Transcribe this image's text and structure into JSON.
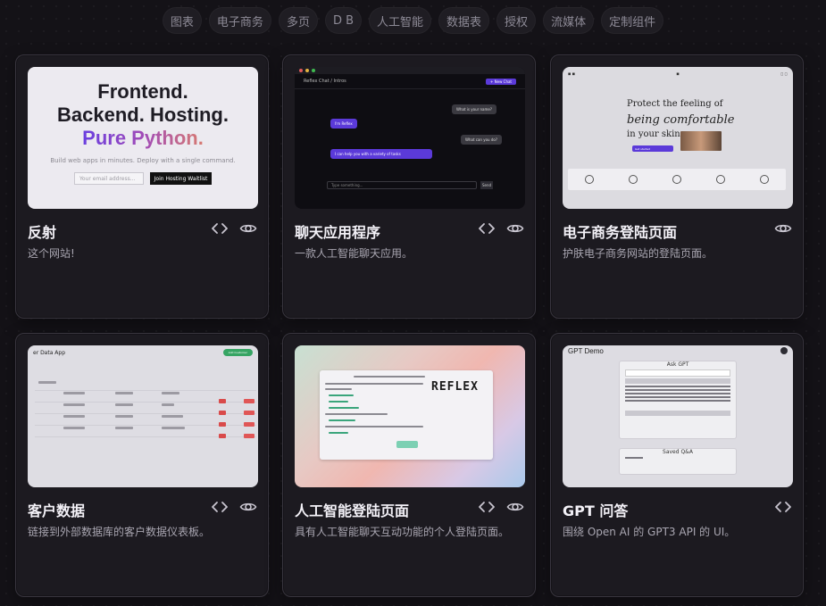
{
  "filters": [
    "图表",
    "电子商务",
    "多页",
    "D B",
    "人工智能",
    "数据表",
    "授权",
    "流媒体",
    "定制组件"
  ],
  "cards": [
    {
      "title": "反射",
      "description": "这个网站!",
      "show_code": true,
      "preview": {
        "line1": "Frontend.",
        "line2": "Backend. Hosting.",
        "line3": "Pure Python.",
        "sub": "Build web apps in minutes. Deploy with a single command.",
        "email_placeholder": "Your email address...",
        "join_button": "Join Hosting Waitlist"
      }
    },
    {
      "title": "聊天应用程序",
      "description": "一款人工智能聊天应用。",
      "show_code": true,
      "preview": {
        "header": "Reflex Chat / Intros",
        "new_chat": "+ New Chat",
        "msg1": "What is your name?",
        "msg2": "I'm Reflex",
        "msg3": "What can you do?",
        "msg4": "I can help you with a variety of tasks",
        "input_placeholder": "Type something...",
        "send": "Send"
      }
    },
    {
      "title": "电子商务登陆页面",
      "description": "护肤电子商务网站的登陆页面。",
      "show_code": false,
      "preview": {
        "line1": "Protect the feeling of",
        "line2": "being comfortable",
        "line3": "in your skin.",
        "cta": "Get started"
      }
    },
    {
      "title": "客户数据",
      "description": "链接到外部数据库的客户数据仪表板。",
      "show_code": true,
      "preview": {
        "header": "er Data App",
        "add_button": "Add Customer"
      }
    },
    {
      "title": "人工智能登陆页面",
      "description": "具有人工智能聊天互动功能的个人登陆页面。",
      "show_code": true,
      "preview": {
        "logo": "REFLEX"
      }
    },
    {
      "title": "GPT 问答",
      "description": "围绕 Open AI 的 GPT3 API 的 UI。",
      "show_code": true,
      "show_preview": false,
      "preview": {
        "header": "GPT Demo",
        "ask": "Ask GPT",
        "saved": "Saved Q&A"
      }
    }
  ]
}
